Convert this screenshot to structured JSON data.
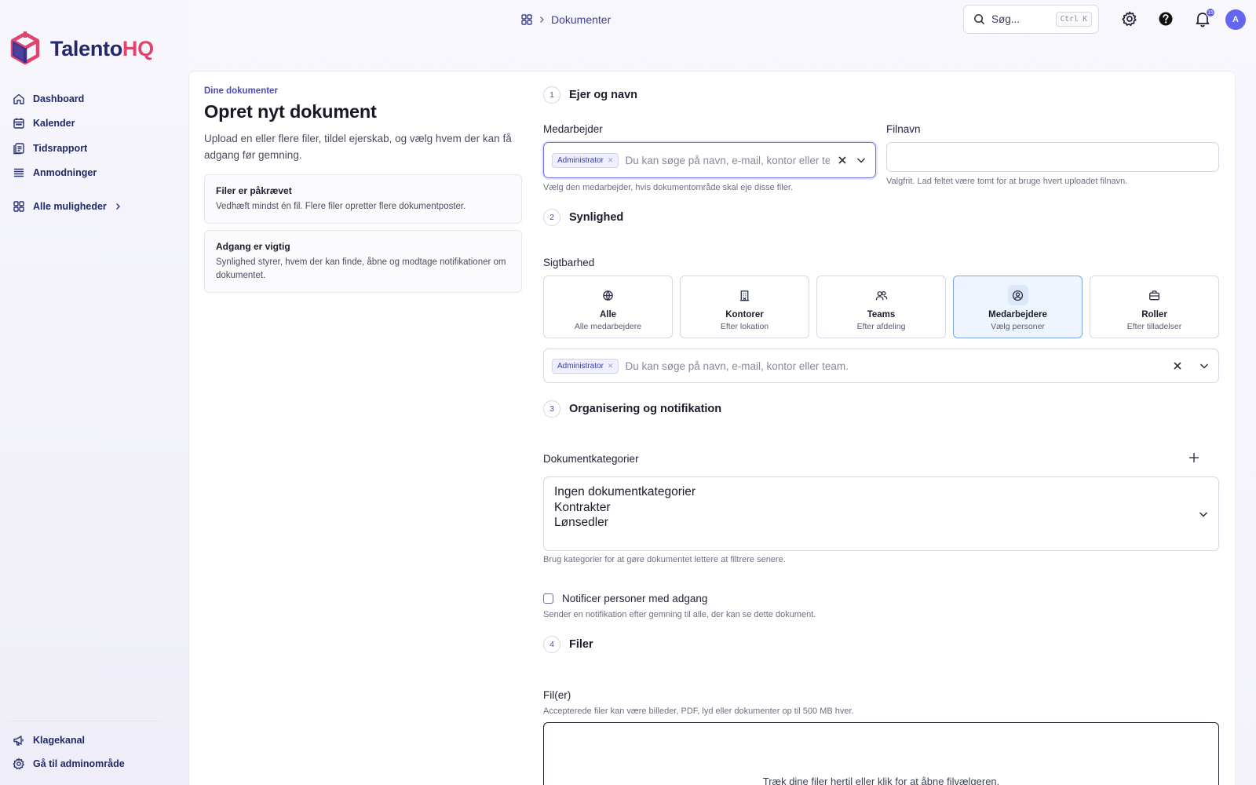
{
  "brand": {
    "name_main": "Talento",
    "name_accent": "HQ"
  },
  "sidebar": {
    "items": [
      {
        "label": "Dashboard",
        "icon": "home-icon"
      },
      {
        "label": "Kalender",
        "icon": "calendar-icon"
      },
      {
        "label": "Tidsrapport",
        "icon": "timesheet-icon"
      },
      {
        "label": "Anmodninger",
        "icon": "list-icon"
      }
    ],
    "all_options": "Alle muligheder",
    "bottom": [
      {
        "label": "Klagekanal",
        "icon": "megaphone-icon"
      },
      {
        "label": "Gå til adminområde",
        "icon": "gear-icon"
      }
    ]
  },
  "topbar": {
    "breadcrumb_current": "Dokumenter",
    "search_placeholder": "Søg...",
    "search_shortcut": "Ctrl K",
    "notification_count": "15",
    "avatar_initial": "A"
  },
  "intro": {
    "eyebrow": "Dine dokumenter",
    "title": "Opret nyt dokument",
    "description": "Upload en eller flere filer, tildel ejerskab, og vælg hvem der kan få adgang før gemning.",
    "cards": [
      {
        "title": "Filer er påkrævet",
        "text": "Vedhæft mindst én fil. Flere filer opretter flere dokumentposter."
      },
      {
        "title": "Adgang er vigtig",
        "text": "Synlighed styrer, hvem der kan finde, åbne og modtage notifikationer om dokumentet."
      }
    ]
  },
  "steps": [
    {
      "num": "1",
      "title": "Ejer og navn"
    },
    {
      "num": "2",
      "title": "Synlighed"
    },
    {
      "num": "3",
      "title": "Organisering og notifikation"
    },
    {
      "num": "4",
      "title": "Filer"
    }
  ],
  "owner": {
    "label": "Medarbejder",
    "tag": "Administrator",
    "placeholder": "Du kan søge på navn, e-mail, kontor eller team.",
    "help": "Vælg den medarbejder, hvis dokumentområde skal eje disse filer."
  },
  "filename": {
    "label": "Filnavn",
    "value": "",
    "help": "Valgfrit. Lad feltet være tomt for at bruge hvert uploadet filnavn."
  },
  "visibility": {
    "label": "Sigtbarhed",
    "options": [
      {
        "title": "Alle",
        "sub": "Alle medarbejdere",
        "icon": "globe-icon"
      },
      {
        "title": "Kontorer",
        "sub": "Efter lokation",
        "icon": "building-icon"
      },
      {
        "title": "Teams",
        "sub": "Efter afdeling",
        "icon": "users-icon"
      },
      {
        "title": "Medarbejdere",
        "sub": "Vælg personer",
        "icon": "user-circle-icon"
      },
      {
        "title": "Roller",
        "sub": "Efter tilladelser",
        "icon": "briefcase-icon"
      }
    ],
    "selected": "Medarbejdere",
    "tag": "Administrator",
    "placeholder": "Du kan søge på navn, e-mail, kontor eller team."
  },
  "categories": {
    "label": "Dokumentkategorier",
    "options": [
      "Ingen dokumentkategorier",
      "Kontrakter",
      "Lønsedler"
    ],
    "help": "Brug kategorier for at gøre dokumentet lettere at filtrere senere."
  },
  "notify": {
    "label": "Notificer personer med adgang",
    "checked": false,
    "help": "Sender en notifikation efter gemning til alle, der kan se dette dokument."
  },
  "files": {
    "label": "Fil(er)",
    "help": "Accepterede filer kan være billeder, PDF, lyd eller dokumenter op til 500 MB hver.",
    "dropzone_text": "Træk dine filer hertil eller klik for at åbne filvælgeren."
  }
}
